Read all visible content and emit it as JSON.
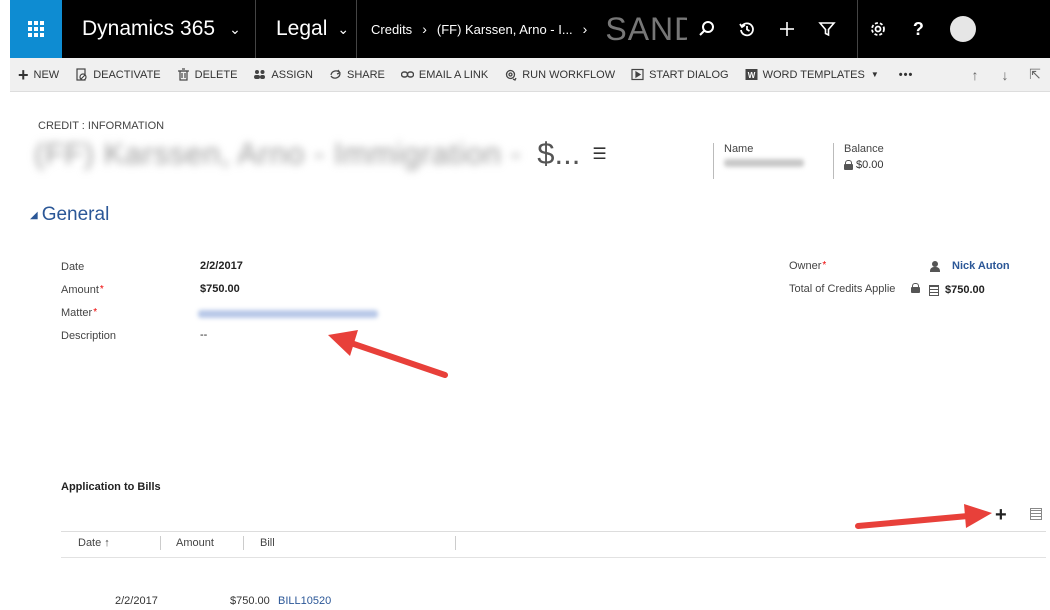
{
  "topnav": {
    "brand": "Dynamics 365",
    "area": "Legal",
    "breadcrumb": [
      "Credits",
      "(FF) Karssen, Arno - I..."
    ],
    "sandbox": "SANDBOX"
  },
  "commands": {
    "new": "NEW",
    "deactivate": "DEACTIVATE",
    "delete": "DELETE",
    "assign": "ASSIGN",
    "share": "SHARE",
    "email_link": "EMAIL A LINK",
    "run_workflow": "RUN WORKFLOW",
    "start_dialog": "START DIALOG",
    "word_templates": "WORD TEMPLATES",
    "more": "•••"
  },
  "header": {
    "form_type": "CREDIT : INFORMATION",
    "title_blurred": "(FF) Karssen, Arno - Immigration -",
    "title_suffix": "$...",
    "name_label": "Name",
    "balance_label": "Balance",
    "balance_value": "$0.00"
  },
  "section": {
    "title": "General",
    "fields": {
      "date_label": "Date",
      "date_value": "2/2/2017",
      "amount_label": "Amount",
      "amount_value": "$750.00",
      "matter_label": "Matter",
      "description_label": "Description",
      "description_value": "--",
      "owner_label": "Owner",
      "owner_value": "Nick Auton",
      "total_label": "Total of Credits Applie",
      "total_value": "$750.00"
    }
  },
  "subgrid": {
    "title": "Application to Bills",
    "columns": [
      "Date ↑",
      "Amount",
      "Bill"
    ],
    "rows": [
      {
        "date": "2/2/2017",
        "amount": "$750.00",
        "bill": "BILL10520"
      }
    ]
  },
  "colors": {
    "nav_bg": "#000000",
    "waffle_bg": "#0e8cd2",
    "link": "#2b5797",
    "arrow": "#e8403a"
  }
}
